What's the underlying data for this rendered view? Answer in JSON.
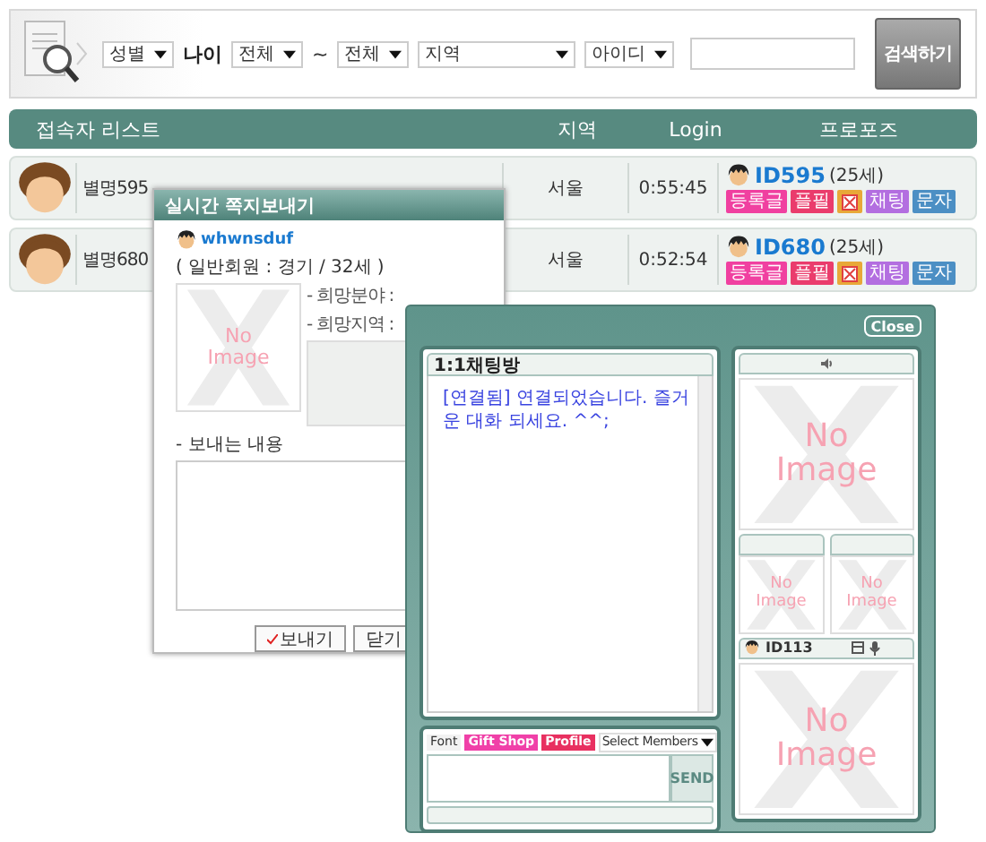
{
  "search": {
    "gender": "성별",
    "age_label": "나이",
    "age_from": "전체",
    "age_sep": "~",
    "age_to": "전체",
    "region": "지역",
    "id_type": "아이디",
    "button": "검색하기"
  },
  "list_header": {
    "title": "접속자 리스트",
    "columns": [
      "지역",
      "Login",
      "프로포즈"
    ]
  },
  "users": [
    {
      "nickname": "별명595",
      "region": "서울",
      "login": "0:55:45",
      "id": "ID595",
      "age": "(25세)",
      "actions": [
        {
          "kind": "text",
          "label": "등록글",
          "color": "#f040a0"
        },
        {
          "kind": "text",
          "label": "플필",
          "color": "#ea3c6c"
        },
        {
          "kind": "icon",
          "color": "#e8a838"
        },
        {
          "kind": "text",
          "label": "채팅",
          "color": "#b36ee0"
        },
        {
          "kind": "text",
          "label": "문자",
          "color": "#4c8fc4"
        }
      ]
    },
    {
      "nickname": "별명680",
      "region": "서울",
      "login": "0:52:54",
      "id": "ID680",
      "age": "(25세)",
      "actions": [
        {
          "kind": "text",
          "label": "등록글",
          "color": "#f040a0"
        },
        {
          "kind": "text",
          "label": "플필",
          "color": "#ea3c6c"
        },
        {
          "kind": "icon",
          "color": "#e8a838"
        },
        {
          "kind": "text",
          "label": "채팅",
          "color": "#b36ee0"
        },
        {
          "kind": "text",
          "label": "문자",
          "color": "#4c8fc4"
        }
      ]
    }
  ],
  "message_window": {
    "title": "실시간 쪽지보내기",
    "sender": "whwnsduf",
    "sender_info": "( 일반회원 : 경기 / 32세 )",
    "photo": "No Image",
    "fields": [
      "- 희망분야 :",
      "- 희망지역 :"
    ],
    "content_label": "- 보내는 내용",
    "buttons": [
      {
        "kind": "send",
        "label": "보내기"
      },
      {
        "kind": "plain",
        "label": "닫기"
      }
    ]
  },
  "chat_window": {
    "close": "Close",
    "title": "1:1채팅방",
    "messages": [
      "[연결됨] 연결되었습니다. 즐거운 대화 되세요. ^^;"
    ],
    "font": "Font",
    "gift_shop": "Gift Shop",
    "profile": "Profile",
    "members": "Select Members",
    "send": "SEND",
    "main_video": "No Image",
    "small_videos": [
      "No Image",
      "No Image"
    ],
    "partner": {
      "id": "ID113",
      "video": "No Image"
    }
  }
}
